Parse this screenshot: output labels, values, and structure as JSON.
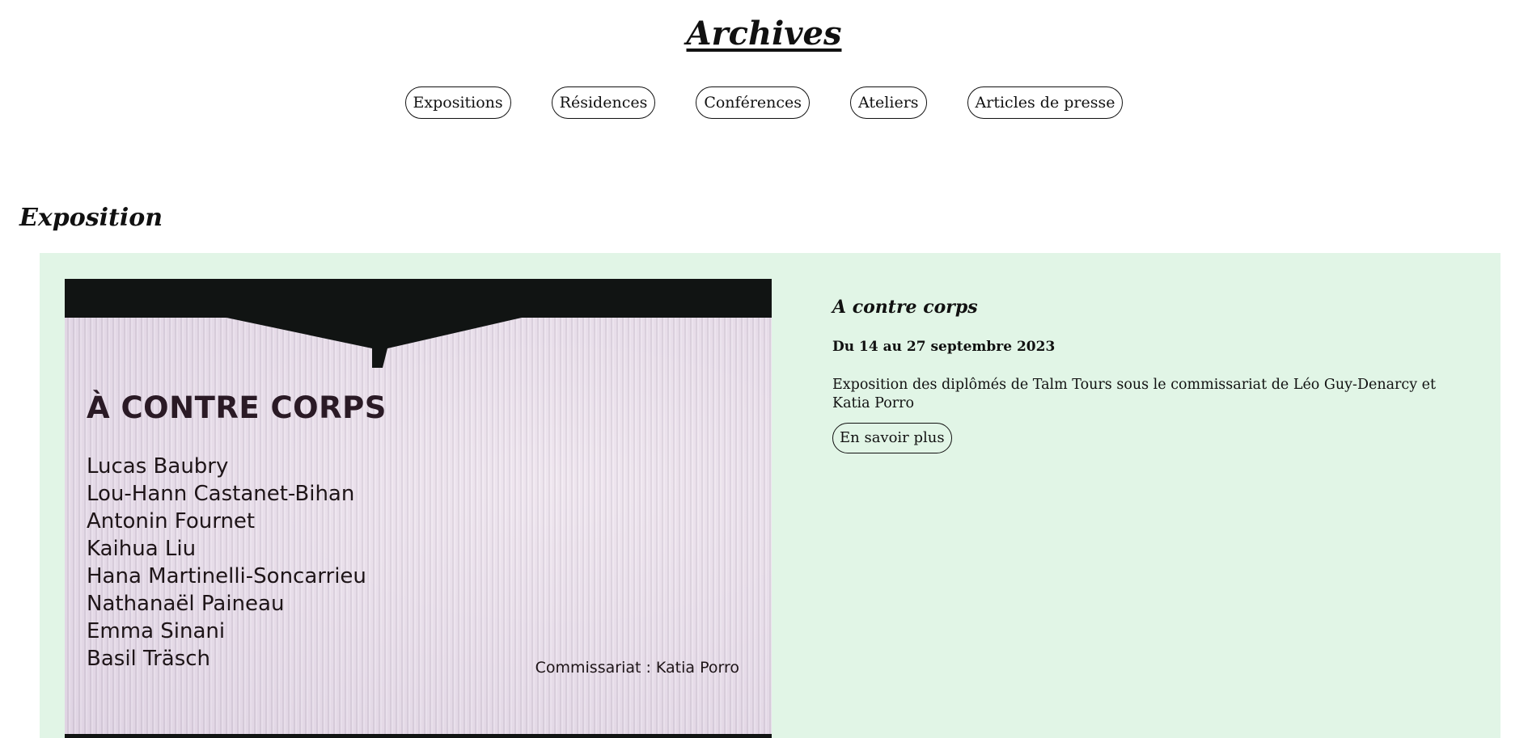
{
  "header": {
    "title": "Archives"
  },
  "nav": [
    {
      "label": "Expositions"
    },
    {
      "label": "Résidences"
    },
    {
      "label": "Conférences"
    },
    {
      "label": "Ateliers"
    },
    {
      "label": "Articles de presse"
    }
  ],
  "section": {
    "heading": "Exposition"
  },
  "exhibition": {
    "title": "A contre corps",
    "dates": "Du 14 au 27 septembre 2023",
    "description": "Exposition des diplômés de Talm Tours sous le commissariat de Léo Guy-Denarcy et Katia Porro",
    "more_label": "En savoir plus",
    "card_color": "#e1f5e6",
    "poster": {
      "title": "À CONTRE CORPS",
      "artists": [
        "Lucas Baubry",
        "Lou-Hann Castanet-Bihan",
        "Antonin Fournet",
        "Kaihua Liu",
        "Hana Martinelli-Soncarrieu",
        "Nathanaël Paineau",
        "Emma Sinani",
        "Basil Träsch"
      ],
      "curator": "Commissariat : Katia Porro"
    }
  }
}
